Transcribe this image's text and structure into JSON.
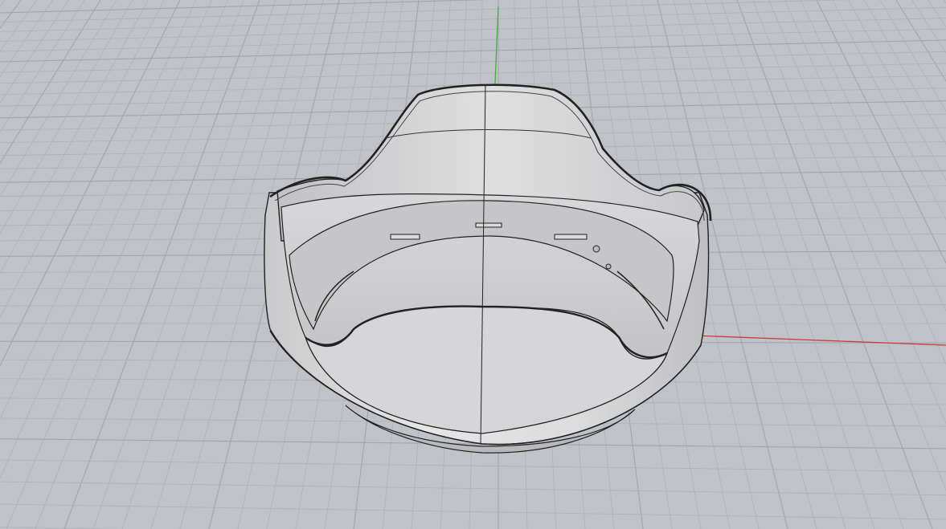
{
  "viewport": {
    "view": "perspective",
    "background_color": "#bfc3c8",
    "grid": {
      "minor_line_color": "#aeb2b8",
      "major_line_color": "#a2a7ae",
      "visible": true
    },
    "axes": {
      "x_axis_color": "#cc3b3b",
      "y_axis_color": "#3fae3f"
    },
    "model": {
      "object": "lens-hood",
      "outer_surface_color": "#dcdcdd",
      "inner_surface_color": "#cfcfd1",
      "edge_color": "#222222"
    }
  }
}
